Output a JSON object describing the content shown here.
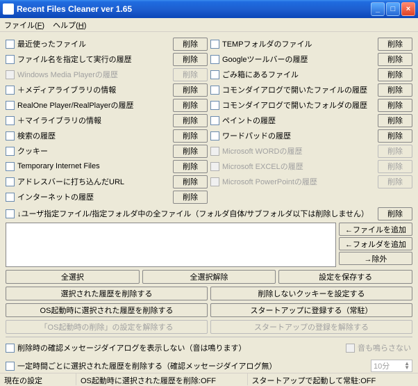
{
  "window": {
    "title": "Recent Files Cleaner ver 1.65",
    "min": "_",
    "max": "□",
    "close": "×"
  },
  "menu": {
    "file": "ファイル(F)",
    "help": "ヘルプ(H)"
  },
  "delete_label": "削除",
  "left": [
    {
      "label": "最近使ったファイル",
      "enabled": true
    },
    {
      "label": "ファイル名を指定して実行の履歴",
      "enabled": true
    },
    {
      "label": "Windows Media Playerの履歴",
      "enabled": false
    },
    {
      "label": "＋メディアライブラリの情報",
      "enabled": true
    },
    {
      "label": "RealOne Player/RealPlayerの履歴",
      "enabled": true
    },
    {
      "label": "＋マイライブラリの情報",
      "enabled": true
    },
    {
      "label": "検索の履歴",
      "enabled": true
    },
    {
      "label": "クッキー",
      "enabled": true
    },
    {
      "label": "Temporary Internet Files",
      "enabled": true
    },
    {
      "label": "アドレスバーに打ち込んだURL",
      "enabled": true
    },
    {
      "label": "インターネットの履歴",
      "enabled": true
    }
  ],
  "right": [
    {
      "label": "TEMPフォルダのファイル",
      "enabled": true
    },
    {
      "label": "Googleツールバーの履歴",
      "enabled": true
    },
    {
      "label": "ごみ箱にあるファイル",
      "enabled": true
    },
    {
      "label": "コモンダイアログで開いたファイルの履歴",
      "enabled": true
    },
    {
      "label": "コモンダイアログで開いたフォルダの履歴",
      "enabled": true
    },
    {
      "label": "ペイントの履歴",
      "enabled": true
    },
    {
      "label": "ワードパッドの履歴",
      "enabled": true
    },
    {
      "label": "Microsoft WORDの履歴",
      "enabled": false
    },
    {
      "label": "Microsoft EXCELの履歴",
      "enabled": false
    },
    {
      "label": "Microsoft PowerPointの履歴",
      "enabled": false
    }
  ],
  "user_folder_label": "↓ユーザ指定ファイル/指定フォルダ中の全ファイル（フォルダ自体/サブフォルダ以下は削除しません）",
  "filebtns": {
    "add_file": "←ファイルを追加",
    "add_folder": "←フォルダを追加",
    "exclude": "→除外"
  },
  "btns": {
    "select_all": "全選択",
    "deselect_all": "全選択解除",
    "save_settings": "設定を保存する",
    "delete_selected": "選択された履歴を削除する",
    "cookie_settings": "削除しないクッキーを設定する",
    "delete_on_boot": "OS起動時に選択された履歴を削除する",
    "register_startup": "スタートアップに登録する（常駐）",
    "cancel_boot_delete": "「OS起動時の削除」の設定を解除する",
    "unregister_startup": "スタートアップの登録を解除する"
  },
  "opts": {
    "no_confirm": "削除時の確認メッセージダイアログを表示しない（音は鳴ります）",
    "no_sound": "音も鳴らさない",
    "interval_delete": "一定時間ごとに選択された履歴を削除する（確認メッセージダイアログ無）",
    "interval_value": "10分"
  },
  "status": {
    "label": "現在の設定",
    "boot": "OS起動時に選択された履歴を削除:OFF",
    "startup": "スタートアップで起動して常駐:OFF"
  }
}
